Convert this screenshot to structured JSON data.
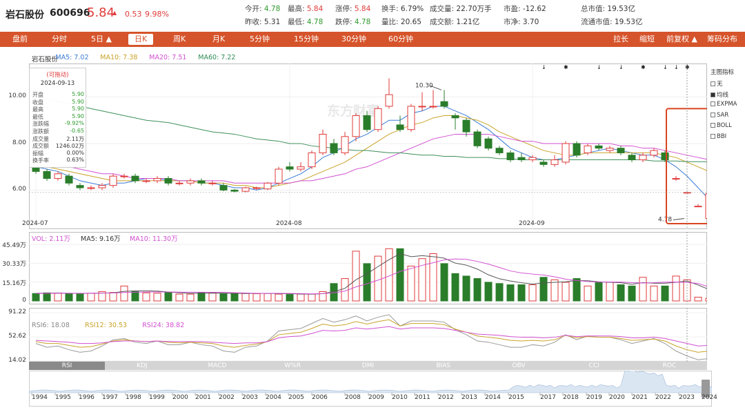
{
  "header": {
    "name": "岩石股份",
    "code": "600696",
    "price": "5.84",
    "change": "0.53",
    "change_pct": "9.98%",
    "quotes": [
      {
        "label": "今开:",
        "value": "4.78",
        "color": "grn",
        "row": 0,
        "col": 0
      },
      {
        "label": "最高:",
        "value": "5.84",
        "color": "red",
        "row": 0,
        "col": 1
      },
      {
        "label": "涨停:",
        "value": "5.84",
        "color": "red",
        "row": 0,
        "col": 2
      },
      {
        "label": "换手:",
        "value": "6.79%",
        "color": "blk",
        "row": 0,
        "col": 3
      },
      {
        "label": "成交量:",
        "value": "22.70万手",
        "color": "blk",
        "row": 0,
        "col": 4
      },
      {
        "label": "市盈:",
        "value": "-12.62",
        "color": "blk",
        "row": 0,
        "col": 5
      },
      {
        "label": "总市值:",
        "value": "19.53亿",
        "color": "blk",
        "row": 0,
        "col": 6
      },
      {
        "label": "昨收:",
        "value": "5.31",
        "color": "blk",
        "row": 1,
        "col": 0
      },
      {
        "label": "最低:",
        "value": "4.78",
        "color": "grn",
        "row": 1,
        "col": 1
      },
      {
        "label": "跌停:",
        "value": "4.78",
        "color": "grn",
        "row": 1,
        "col": 2
      },
      {
        "label": "量比:",
        "value": "20.65",
        "color": "blk",
        "row": 1,
        "col": 3
      },
      {
        "label": "成交额:",
        "value": "1.21亿",
        "color": "blk",
        "row": 1,
        "col": 4
      },
      {
        "label": "市净:",
        "value": "3.70",
        "color": "blk",
        "row": 1,
        "col": 5
      },
      {
        "label": "流通市值:",
        "value": "19.53亿",
        "color": "blk",
        "row": 1,
        "col": 6
      }
    ]
  },
  "tabs": {
    "left": [
      "盘前",
      "分时",
      "5日 ▲",
      "日K",
      "周K",
      "月K",
      "5分钟",
      "15分钟",
      "30分钟",
      "60分钟"
    ],
    "active": "日K",
    "right": [
      "拉长",
      "缩短",
      "前复权 ▲",
      "筹码分布"
    ]
  },
  "legend_main": [
    {
      "text": "岩石股份",
      "color": "#333333"
    },
    {
      "text": "MA5: 7.02",
      "color": "#3a7bd5"
    },
    {
      "text": "MA10: 7.38",
      "color": "#c9a227"
    },
    {
      "text": "MA20: 7.51",
      "color": "#d14fd1"
    },
    {
      "text": "MA60: 7.22",
      "color": "#2e8b57"
    }
  ],
  "legend_vol": [
    {
      "text": "VOL: 2.11万",
      "color": "#d14fd1"
    },
    {
      "text": "MA5: 9.16万",
      "color": "#333333"
    },
    {
      "text": "MA10: 11.30万",
      "color": "#d14fd1"
    }
  ],
  "legend_rsi": [
    {
      "text": "RSI6: 18.08",
      "color": "#888888"
    },
    {
      "text": "RSI12: 30.53",
      "color": "#c9a227"
    },
    {
      "text": "RSI24: 38.82",
      "color": "#d14fd1"
    }
  ],
  "tooltip": {
    "title": "(可拖动)",
    "date": "2024-09-13",
    "rows": [
      {
        "k": "开盘",
        "v": "5.90",
        "c": "#2e9a2e"
      },
      {
        "k": "收盘",
        "v": "5.90",
        "c": "#2e9a2e"
      },
      {
        "k": "最高",
        "v": "5.90",
        "c": "#2e9a2e"
      },
      {
        "k": "最低",
        "v": "5.90",
        "c": "#2e9a2e"
      },
      {
        "k": "涨跌幅",
        "v": "-9.92%",
        "c": "#2e9a2e"
      },
      {
        "k": "涨跌额",
        "v": "-0.65",
        "c": "#2e9a2e"
      },
      {
        "k": "成交量",
        "v": "2.11万",
        "c": "#333333"
      },
      {
        "k": "成交额",
        "v": "1246.02万",
        "c": "#333333"
      },
      {
        "k": "振幅",
        "v": "0.00%",
        "c": "#333333"
      },
      {
        "k": "换手率",
        "v": "0.63%",
        "c": "#333333"
      }
    ]
  },
  "sidebar": {
    "title": "主图指标",
    "items": [
      {
        "label": "无",
        "checked": false
      },
      {
        "label": "均线",
        "checked": true
      },
      {
        "label": "EXPMA",
        "checked": false
      },
      {
        "label": "SAR",
        "checked": false
      },
      {
        "label": "BOLL",
        "checked": false
      },
      {
        "label": "BBI",
        "checked": false
      }
    ]
  },
  "indicator_tabs": [
    "RSI",
    "KDJ",
    "MACD",
    "W%R",
    "DMI",
    "BIAS",
    "OBV",
    "CCI",
    "ROC"
  ],
  "indicator_active": "RSI",
  "watermark": "东方财富",
  "years": [
    "1994",
    "1995",
    "1996",
    "1997",
    "1998",
    "1999",
    "2000",
    "2001",
    "2002",
    "2003",
    "2004",
    "2005",
    "2006",
    "2008",
    "2009",
    "2010",
    "2011",
    "2012",
    "2013",
    "2014",
    "2015",
    "2017",
    "2018",
    "2019",
    "2020",
    "2021",
    "2022",
    "2023",
    "2024"
  ],
  "colors": {
    "up": "#e03a3a",
    "down": "#2a7d2a",
    "accent": "#d6542b",
    "highlight": "#d9441f"
  },
  "chart_data": {
    "type": "candlestick",
    "price_axis": {
      "ticks": [
        10.0,
        8.0,
        6.0
      ],
      "tick_labels": [
        "10.00",
        "8.00",
        "6.00"
      ],
      "ylim": [
        4.5,
        11.2
      ]
    },
    "date_ticks": [
      {
        "label": "2024-07",
        "index": 0
      },
      {
        "label": "2024-08",
        "index": 23
      },
      {
        "label": "2024-09",
        "index": 45
      }
    ],
    "annotations": [
      {
        "text": "10.30",
        "index": 37,
        "value": 10.3
      },
      {
        "text": "4.78",
        "index": 59,
        "value": 4.78
      }
    ],
    "candles": [
      [
        7.0,
        6.8,
        7.1,
        6.7
      ],
      [
        6.8,
        6.5,
        6.9,
        6.4
      ],
      [
        6.5,
        6.7,
        6.8,
        6.4
      ],
      [
        6.6,
        6.3,
        6.7,
        6.2
      ],
      [
        6.2,
        6.1,
        6.3,
        6.0
      ],
      [
        6.1,
        6.1,
        6.2,
        6.0
      ],
      [
        6.1,
        6.2,
        6.3,
        6.0
      ],
      [
        6.2,
        6.6,
        6.7,
        6.1
      ],
      [
        6.6,
        6.6,
        6.7,
        6.5
      ],
      [
        6.6,
        6.4,
        6.7,
        6.3
      ],
      [
        6.4,
        6.4,
        6.5,
        6.3
      ],
      [
        6.4,
        6.5,
        6.6,
        6.3
      ],
      [
        6.5,
        6.3,
        6.6,
        6.2
      ],
      [
        6.3,
        6.3,
        6.4,
        6.2
      ],
      [
        6.3,
        6.4,
        6.5,
        6.2
      ],
      [
        6.4,
        6.3,
        6.5,
        6.2
      ],
      [
        6.3,
        6.3,
        6.4,
        6.2
      ],
      [
        6.2,
        6.0,
        6.3,
        5.95
      ],
      [
        6.0,
        5.95,
        6.05,
        5.9
      ],
      [
        5.95,
        6.1,
        6.15,
        5.9
      ],
      [
        6.1,
        6.1,
        6.15,
        6.0
      ],
      [
        6.05,
        6.3,
        6.35,
        6.0
      ],
      [
        6.3,
        6.9,
        7.0,
        6.2
      ],
      [
        7.0,
        6.9,
        7.2,
        6.8
      ],
      [
        6.9,
        7.0,
        7.2,
        6.8
      ],
      [
        7.0,
        7.6,
        7.7,
        6.9
      ],
      [
        7.6,
        8.4,
        8.6,
        7.5
      ],
      [
        8.0,
        7.6,
        8.2,
        7.5
      ],
      [
        7.6,
        8.3,
        8.5,
        7.5
      ],
      [
        8.3,
        9.2,
        9.3,
        8.1
      ],
      [
        9.2,
        8.6,
        9.4,
        8.5
      ],
      [
        8.6,
        9.5,
        9.6,
        8.5
      ],
      [
        9.6,
        10.1,
        10.8,
        9.5
      ],
      [
        8.8,
        8.6,
        9.2,
        8.5
      ],
      [
        8.6,
        9.6,
        9.7,
        8.5
      ],
      [
        9.6,
        9.6,
        10.2,
        9.4
      ],
      [
        9.6,
        9.6,
        10.3,
        9.5
      ],
      [
        9.8,
        9.6,
        10.3,
        9.5
      ],
      [
        9.2,
        9.1,
        9.3,
        8.6
      ],
      [
        9.0,
        8.5,
        9.1,
        8.3
      ],
      [
        8.5,
        7.9,
        8.6,
        7.8
      ],
      [
        8.2,
        7.8,
        8.3,
        7.7
      ],
      [
        7.8,
        7.6,
        7.9,
        7.5
      ],
      [
        7.6,
        7.3,
        7.7,
        7.2
      ],
      [
        7.4,
        7.3,
        7.6,
        7.2
      ],
      [
        7.3,
        7.4,
        7.5,
        7.2
      ],
      [
        7.2,
        7.1,
        7.3,
        7.0
      ],
      [
        7.1,
        7.3,
        7.5,
        7.0
      ],
      [
        7.2,
        8.0,
        8.1,
        7.1
      ],
      [
        8.0,
        7.5,
        8.1,
        7.4
      ],
      [
        7.6,
        7.9,
        8.0,
        7.5
      ],
      [
        7.9,
        7.8,
        8.0,
        7.7
      ],
      [
        7.7,
        7.8,
        7.9,
        7.6
      ],
      [
        7.8,
        7.6,
        7.9,
        7.5
      ],
      [
        7.5,
        7.3,
        7.6,
        7.2
      ],
      [
        7.3,
        7.5,
        7.6,
        7.2
      ],
      [
        7.5,
        7.7,
        7.8,
        7.4
      ],
      [
        7.6,
        7.3,
        7.7,
        7.2
      ],
      [
        6.5,
        6.5,
        6.6,
        6.4
      ],
      [
        5.9,
        5.9,
        5.9,
        5.9
      ],
      [
        5.31,
        5.31,
        5.4,
        5.28
      ],
      [
        4.78,
        5.84,
        5.84,
        4.78
      ]
    ],
    "ma": {
      "MA5": [
        7.0,
        6.9,
        6.8,
        6.6,
        6.4,
        6.3,
        6.2,
        6.3,
        6.3,
        6.4,
        6.5,
        6.5,
        6.4,
        6.4,
        6.4,
        6.3,
        6.3,
        6.2,
        6.1,
        6.1,
        6.0,
        6.1,
        6.3,
        6.5,
        6.7,
        7.0,
        7.4,
        7.6,
        7.9,
        8.2,
        8.4,
        8.7,
        9.0,
        9.0,
        9.3,
        9.4,
        9.6,
        9.6,
        9.4,
        9.2,
        8.9,
        8.6,
        8.2,
        7.8,
        7.6,
        7.4,
        7.3,
        7.3,
        7.4,
        7.5,
        7.6,
        7.7,
        7.8,
        7.7,
        7.6,
        7.5,
        7.5,
        7.3,
        7.0,
        6.6,
        6.1,
        5.6
      ],
      "MA10": [
        7.1,
        7.0,
        6.9,
        6.8,
        6.7,
        6.6,
        6.5,
        6.4,
        6.4,
        6.4,
        6.4,
        6.4,
        6.4,
        6.4,
        6.4,
        6.3,
        6.3,
        6.3,
        6.2,
        6.2,
        6.1,
        6.1,
        6.2,
        6.3,
        6.4,
        6.6,
        6.8,
        7.0,
        7.2,
        7.5,
        7.8,
        8.1,
        8.4,
        8.6,
        8.8,
        8.9,
        9.1,
        9.2,
        9.2,
        9.1,
        9.0,
        8.8,
        8.5,
        8.3,
        8.1,
        7.9,
        7.7,
        7.6,
        7.5,
        7.5,
        7.6,
        7.6,
        7.6,
        7.6,
        7.6,
        7.6,
        7.6,
        7.5,
        7.4,
        7.2,
        7.0,
        6.8
      ],
      "MA20": [
        7.3,
        7.2,
        7.1,
        7.0,
        6.9,
        6.8,
        6.7,
        6.7,
        6.6,
        6.5,
        6.5,
        6.5,
        6.5,
        6.4,
        6.4,
        6.4,
        6.4,
        6.4,
        6.3,
        6.3,
        6.3,
        6.3,
        6.3,
        6.3,
        6.4,
        6.4,
        6.5,
        6.6,
        6.7,
        6.9,
        7.0,
        7.2,
        7.4,
        7.6,
        7.8,
        8.0,
        8.2,
        8.3,
        8.4,
        8.4,
        8.4,
        8.4,
        8.3,
        8.2,
        8.1,
        8.1,
        8.0,
        8.0,
        8.0,
        8.0,
        8.0,
        8.0,
        8.0,
        7.9,
        7.9,
        7.8,
        7.8,
        7.7,
        7.6,
        7.5,
        7.4,
        7.3
      ],
      "MA60": [
        10.0,
        9.9,
        9.8,
        9.7,
        9.6,
        9.5,
        9.4,
        9.3,
        9.2,
        9.1,
        9.0,
        8.95,
        8.9,
        8.8,
        8.7,
        8.6,
        8.5,
        8.45,
        8.4,
        8.3,
        8.2,
        8.15,
        8.1,
        8.0,
        8.0,
        7.9,
        7.85,
        7.8,
        7.75,
        7.7,
        7.7,
        7.65,
        7.6,
        7.6,
        7.55,
        7.5,
        7.5,
        7.45,
        7.45,
        7.4,
        7.4,
        7.4,
        7.35,
        7.35,
        7.3,
        7.3,
        7.3,
        7.3,
        7.3,
        7.3,
        7.3,
        7.3,
        7.3,
        7.3,
        7.3,
        7.3,
        7.25,
        7.25,
        7.25,
        7.22,
        7.22,
        7.22
      ]
    },
    "volume_axis": {
      "tick_labels": [
        "45.49万",
        "30.33万",
        "15.16万",
        "0"
      ],
      "ticks": [
        45.49,
        30.33,
        15.16,
        0
      ],
      "ylim": [
        0,
        45.49
      ]
    },
    "volume": [
      6,
      6.5,
      6.4,
      5.8,
      5.5,
      6.2,
      7.5,
      6.8,
      12,
      7.5,
      6.5,
      6.2,
      6.8,
      5.5,
      5.5,
      6.8,
      6.4,
      6,
      6,
      6,
      5.8,
      6,
      5.5,
      5.2,
      5.5,
      5.5,
      7.5,
      14,
      18,
      40,
      30,
      36,
      42,
      42,
      28,
      34,
      38,
      30,
      22,
      20,
      18,
      15,
      14,
      13,
      13,
      13,
      19,
      17,
      15,
      18,
      12,
      15,
      15,
      13,
      12,
      19,
      12,
      12,
      20,
      17,
      3,
      2.11
    ],
    "volume_ma5": [
      6.2,
      6.3,
      6.3,
      6.2,
      6.0,
      6.1,
      6.3,
      6.5,
      7.7,
      8.1,
      8.1,
      7.9,
      7.2,
      6.6,
      6.1,
      6.2,
      6.3,
      6.2,
      6.1,
      6.0,
      6.0,
      6.0,
      5.9,
      5.8,
      5.6,
      5.5,
      5.8,
      7.5,
      10.1,
      17.0,
      21.9,
      27.6,
      33.2,
      38.0,
      35.6,
      36.4,
      35.6,
      34.4,
      30.4,
      28.8,
      25.6,
      21.0,
      17.8,
      16.0,
      14.6,
      13.6,
      14.4,
      15.0,
      15.4,
      16.4,
      16.2,
      15.4,
      15.0,
      14.6,
      13.4,
      14.8,
      14.2,
      14.2,
      15.0,
      16.0,
      12.8,
      9.16
    ],
    "volume_ma10": [
      6.0,
      6.1,
      6.2,
      6.2,
      6.2,
      6.2,
      6.3,
      6.4,
      6.8,
      7.0,
      7.2,
      7.2,
      7.2,
      7.1,
      7.0,
      7.0,
      6.9,
      6.9,
      6.6,
      6.4,
      6.1,
      6.1,
      6.1,
      6.0,
      5.9,
      5.7,
      5.9,
      6.6,
      7.9,
      11.3,
      13.8,
      16.7,
      20.0,
      23.7,
      26.1,
      28.6,
      30.7,
      33.0,
      33.8,
      33.4,
      31.8,
      29.6,
      26.9,
      24.1,
      22.5,
      21.6,
      20.8,
      19.4,
      17.5,
      16.4,
      15.7,
      15.2,
      15.2,
      15.2,
      14.7,
      14.4,
      14.6,
      15.1,
      15.2,
      14.9,
      14.0,
      11.3
    ],
    "rsi_axis": {
      "tick_labels": [
        "91.22",
        "52.62",
        "14.02"
      ],
      "ticks": [
        91.22,
        52.62,
        14.02
      ],
      "ylim": [
        14.02,
        91.22
      ]
    },
    "rsi": {
      "RSI6": [
        42,
        36,
        38,
        32,
        28,
        30,
        38,
        48,
        50,
        44,
        42,
        46,
        40,
        40,
        44,
        40,
        38,
        30,
        28,
        36,
        38,
        46,
        62,
        64,
        66,
        74,
        82,
        76,
        80,
        86,
        78,
        84,
        88,
        70,
        78,
        78,
        78,
        76,
        64,
        56,
        46,
        44,
        40,
        36,
        36,
        40,
        38,
        44,
        56,
        48,
        54,
        52,
        52,
        48,
        42,
        46,
        50,
        42,
        30,
        22,
        16,
        18
      ],
      "RSI12": [
        45,
        42,
        42,
        39,
        36,
        37,
        41,
        46,
        48,
        46,
        45,
        46,
        44,
        43,
        44,
        43,
        42,
        38,
        36,
        39,
        41,
        45,
        56,
        58,
        60,
        66,
        73,
        70,
        72,
        77,
        73,
        77,
        80,
        70,
        74,
        74,
        74,
        72,
        65,
        60,
        54,
        52,
        50,
        47,
        46,
        47,
        46,
        48,
        55,
        51,
        53,
        52,
        52,
        50,
        47,
        48,
        49,
        46,
        38,
        32,
        28,
        30
      ],
      "RSI24": [
        47,
        46,
        45,
        44,
        42,
        42,
        43,
        45,
        46,
        46,
        45,
        46,
        45,
        45,
        45,
        45,
        44,
        43,
        42,
        43,
        43,
        45,
        51,
        53,
        54,
        58,
        63,
        62,
        63,
        67,
        65,
        67,
        69,
        65,
        67,
        67,
        67,
        66,
        63,
        60,
        57,
        56,
        55,
        53,
        52,
        52,
        51,
        52,
        55,
        53,
        54,
        54,
        54,
        53,
        51,
        51,
        52,
        50,
        46,
        42,
        38,
        39
      ]
    }
  }
}
